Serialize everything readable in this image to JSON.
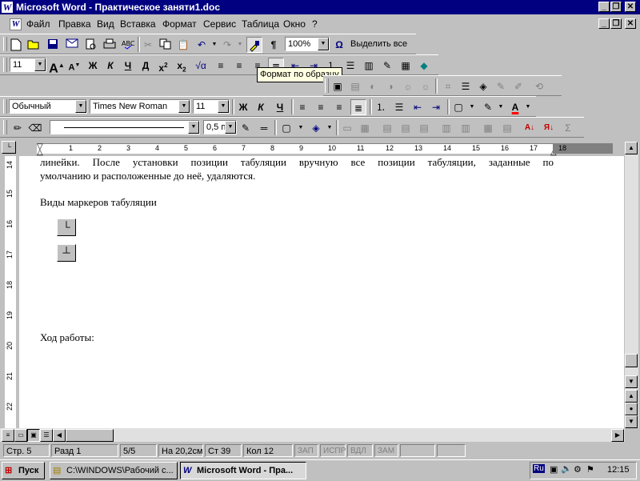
{
  "window": {
    "title": "Microsoft Word - Практическое заняти1.doc",
    "app_icon": "W"
  },
  "menu": [
    "Файл",
    "Правка",
    "Вид",
    "Вставка",
    "Формат",
    "Сервис",
    "Таблица",
    "Окно",
    "?"
  ],
  "toolbar_standard": {
    "zoom": "100%",
    "select_all": "Выделить все"
  },
  "toolbar_formatting_small": {
    "font_size": "11"
  },
  "tooltip": "Формат по образцу",
  "toolbar_formatting": {
    "style": "Обычный",
    "font": "Times New Roman",
    "size": "11"
  },
  "toolbar_drawing": {
    "line_width": "0,5 пт"
  },
  "ruler": {
    "numbers": [
      "1",
      "2",
      "3",
      "4",
      "5",
      "6",
      "7",
      "8",
      "9",
      "10",
      "11",
      "12",
      "13",
      "14",
      "15",
      "16",
      "17",
      "18"
    ],
    "vertical_numbers": [
      "14",
      "15",
      "16",
      "17",
      "18",
      "19",
      "20",
      "21",
      "22"
    ]
  },
  "document": {
    "line1": "линейки. После установки позиции табуляции вручную все позиции табуляции, заданные по",
    "line2": "умолчанию и расположенные до неё, удаляются.",
    "heading": "Виды маркеров табуляции",
    "tab_left": "└",
    "tab_center": "┴",
    "progress": "Ход работы:"
  },
  "status": {
    "page": "Стр. 5",
    "section": "Разд 1",
    "pages": "5/5",
    "position": "На 20,2см",
    "line": "Ст 39",
    "col": "Кол 12",
    "rec": "ЗАП",
    "trk": "ИСПР",
    "ext": "ВДЛ",
    "ovr": "ЗАМ"
  },
  "taskbar": {
    "start": "Пуск",
    "task1": "C:\\WINDOWS\\Рабочий с...",
    "task2": "Microsoft Word - Пра...",
    "lang": "Ru",
    "clock": "12:15"
  },
  "colors": {
    "titlebar": "#000080",
    "face": "#c0c0c0",
    "tooltip": "#ffffe1"
  }
}
